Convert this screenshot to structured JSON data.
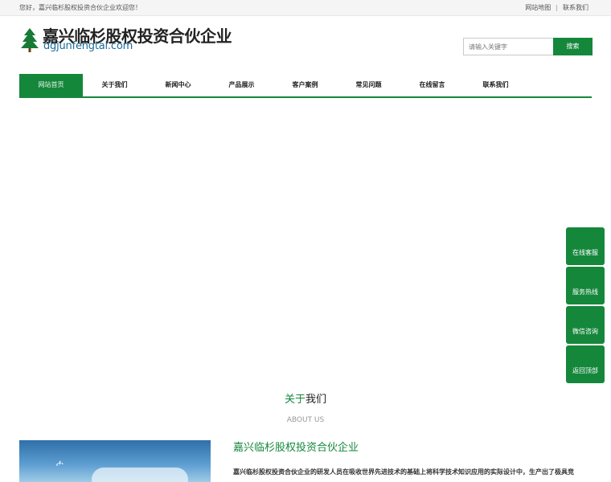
{
  "topbar": {
    "welcome": "您好，嘉兴临杉股权投资合伙企业欢迎您！",
    "links": [
      "网站地图",
      "联系我们"
    ],
    "separator": "|"
  },
  "logo": {
    "name_cn": "嘉兴临杉股权投资合伙企业",
    "domain": "dgjunfengtai.com",
    "icon": "pine-tree-icon"
  },
  "search": {
    "placeholder": "请输入关键字",
    "button": "搜索"
  },
  "nav": {
    "items": [
      "网站首页",
      "关于我们",
      "新闻中心",
      "产品展示",
      "客户案例",
      "常见问题",
      "在线留言",
      "联系我们"
    ],
    "active_index": 0
  },
  "side_buttons": [
    "在线客服",
    "服务热线",
    "微信咨询",
    "返回顶部"
  ],
  "about": {
    "title_green": "关于",
    "title_dark": "我们",
    "subtitle": "ABOUT US",
    "company_name": "嘉兴临杉股权投资合伙企业",
    "text": "嘉兴临杉股权投资合伙企业的研发人员在吸收世界先进技术的基础上将科学技术知识应用的实际设计中，生产出了极具竞"
  },
  "colors": {
    "accent": "#15873b",
    "domain_text": "#1b6b96"
  }
}
